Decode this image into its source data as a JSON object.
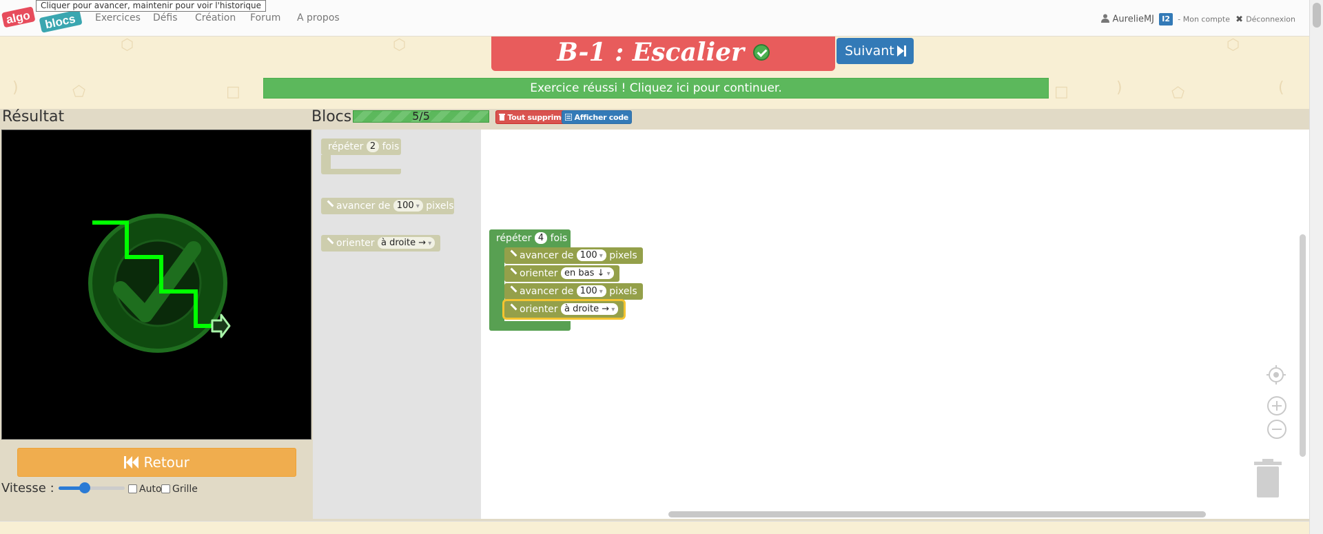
{
  "tooltip": "Cliquer pour avancer, maintenir pour voir l'historique",
  "logo": {
    "part1": "algo",
    "part2": "blocs"
  },
  "nav": [
    "Exercices",
    "Défis",
    "Création",
    "Forum",
    "A propos"
  ],
  "user": {
    "name": "AurelieMJ",
    "badge": "I2",
    "account": "- Mon compte",
    "logout": "Déconnexion"
  },
  "exercise": {
    "title": "B-1 : Escalier",
    "next_label": "Suivant",
    "success": "Exercice réussi ! Cliquez ici pour continuer."
  },
  "result": {
    "title": "Résultat",
    "back_label": "Retour",
    "speed_label": "Vitesse :",
    "speed_value": 0.4,
    "auto_label": "Auto",
    "auto_checked": false,
    "grid_label": "Grille",
    "grid_checked": false
  },
  "blocks": {
    "title": "Blocs",
    "progress": "5/5",
    "delete_all": "Tout supprimer",
    "show_code": "Afficher code"
  },
  "toolbox": {
    "repeat": {
      "prefix": "répéter",
      "value": "2",
      "suffix": "fois"
    },
    "forward": {
      "prefix": "avancer de",
      "value": "100",
      "suffix": "pixels"
    },
    "orient": {
      "prefix": "orienter",
      "value": "à droite →"
    }
  },
  "program": {
    "repeat": {
      "prefix": "répéter",
      "value": "4",
      "suffix": "fois"
    },
    "steps": [
      {
        "prefix": "avancer de",
        "value": "100",
        "suffix": "pixels"
      },
      {
        "prefix": "orienter",
        "value": "en bas ↓",
        "suffix": ""
      },
      {
        "prefix": "avancer de",
        "value": "100",
        "suffix": "pixels"
      },
      {
        "prefix": "orienter",
        "value": "à droite →",
        "suffix": ""
      }
    ]
  },
  "colors": {
    "title_red": "#e85c5c",
    "success_green": "#5cb85c",
    "primary_blue": "#337ab7",
    "back_orange": "#f0ad4e",
    "motion_block": "#94a04a",
    "loop_block": "#58a052",
    "trail_green": "#00ff00"
  }
}
